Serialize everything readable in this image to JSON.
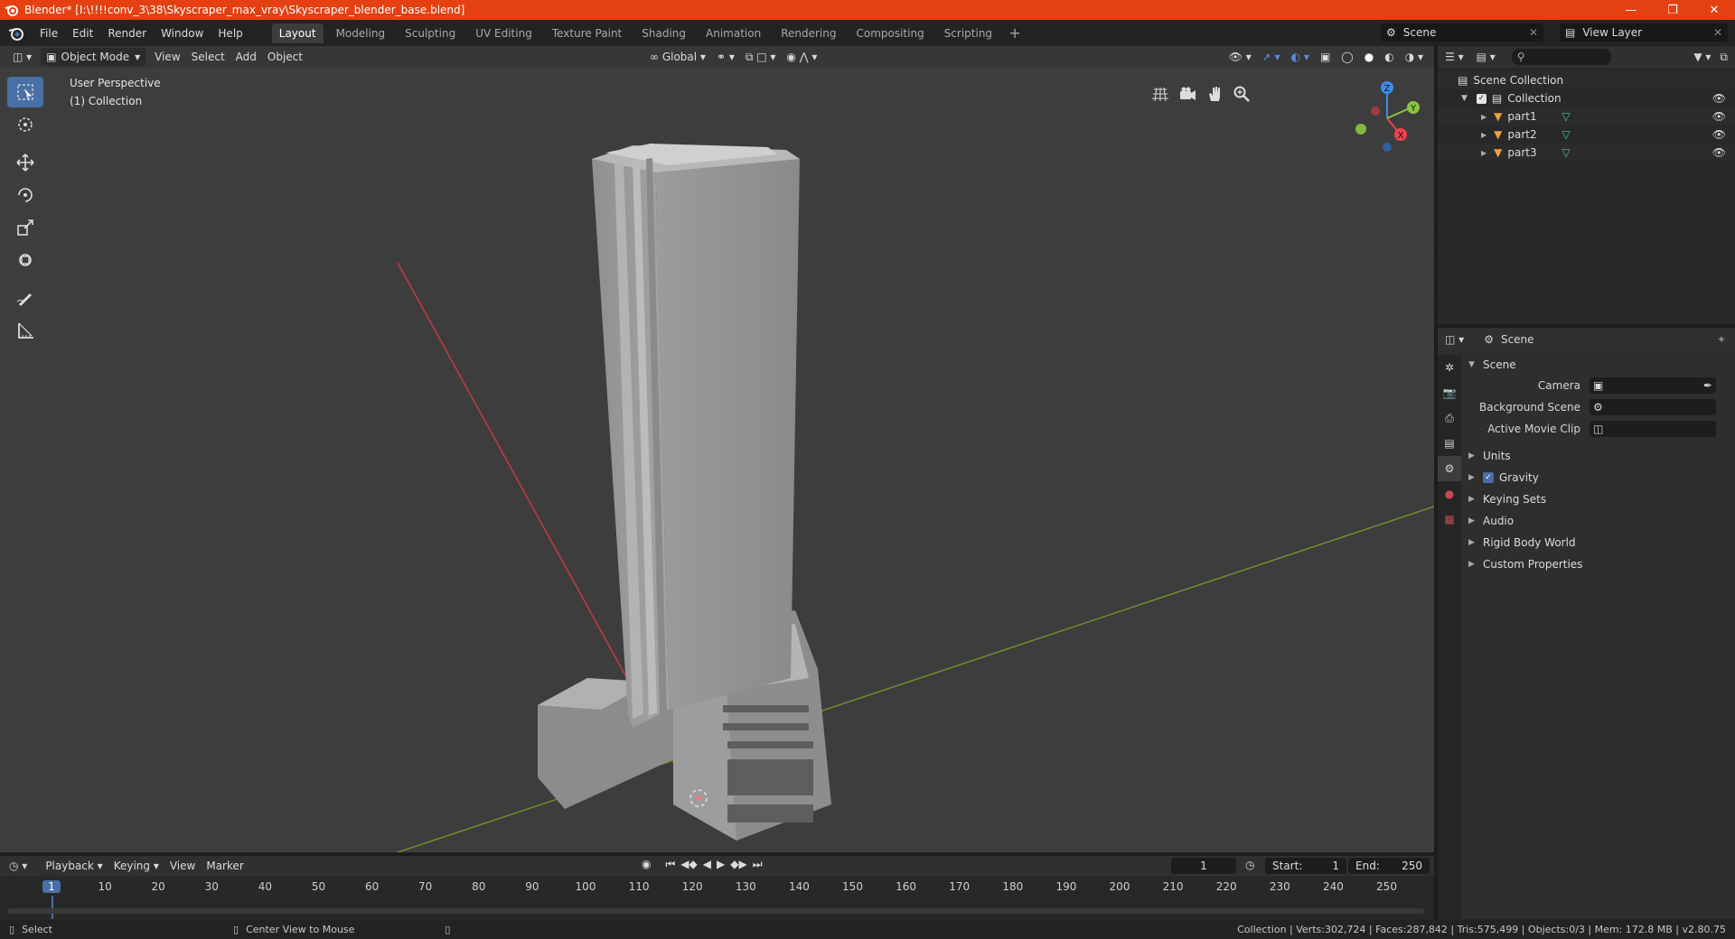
{
  "window": {
    "title": "Blender* [I:\\!!!!conv_3\\38\\Skyscraper_max_vray\\Skyscraper_blender_base.blend]",
    "minimize": "—",
    "maximize": "❐",
    "close": "✕"
  },
  "menu": [
    "File",
    "Edit",
    "Render",
    "Window",
    "Help"
  ],
  "workspaces": [
    "Layout",
    "Modeling",
    "Sculpting",
    "UV Editing",
    "Texture Paint",
    "Shading",
    "Animation",
    "Rendering",
    "Compositing",
    "Scripting"
  ],
  "active_workspace": "Layout",
  "scene_name": "Scene",
  "view_layer": "View Layer",
  "viewport": {
    "mode": "Object Mode",
    "menus": [
      "View",
      "Select",
      "Add",
      "Object"
    ],
    "orientation": "Global",
    "info_line1": "User Perspective",
    "info_line2": "(1) Collection",
    "gizmo": {
      "x": "X",
      "y": "Y",
      "z": "Z"
    }
  },
  "outliner": {
    "root": "Scene Collection",
    "collection": "Collection",
    "items": [
      "part1",
      "part2",
      "part3"
    ]
  },
  "properties": {
    "context": "Scene",
    "panel": "Scene",
    "camera_label": "Camera",
    "bg_scene_label": "Background Scene",
    "movie_clip_label": "Active Movie Clip",
    "subpanels": [
      "Units",
      "Gravity",
      "Keying Sets",
      "Audio",
      "Rigid Body World",
      "Custom Properties"
    ]
  },
  "timeline": {
    "menus": [
      "Playback",
      "Keying",
      "View",
      "Marker"
    ],
    "current_frame": "1",
    "start_label": "Start:",
    "start": "1",
    "end_label": "End:",
    "end": "250",
    "ruler": [
      "1",
      "10",
      "20",
      "30",
      "40",
      "50",
      "60",
      "70",
      "80",
      "90",
      "100",
      "110",
      "120",
      "130",
      "140",
      "150",
      "160",
      "170",
      "180",
      "190",
      "200",
      "210",
      "220",
      "230",
      "240",
      "250"
    ]
  },
  "status": {
    "select": "Select",
    "center": "Center View to Mouse",
    "stats": "Collection | Verts:302,724 | Faces:287,842 | Tris:575,499 | Objects:0/3 | Mem: 172.8 MB | v2.80.75"
  },
  "colors": {
    "titlebar": "#e44012",
    "accent": "#4a6fa5",
    "x_axis": "#f2404f",
    "y_axis": "#8bc53f",
    "z_axis": "#3b8ded"
  }
}
